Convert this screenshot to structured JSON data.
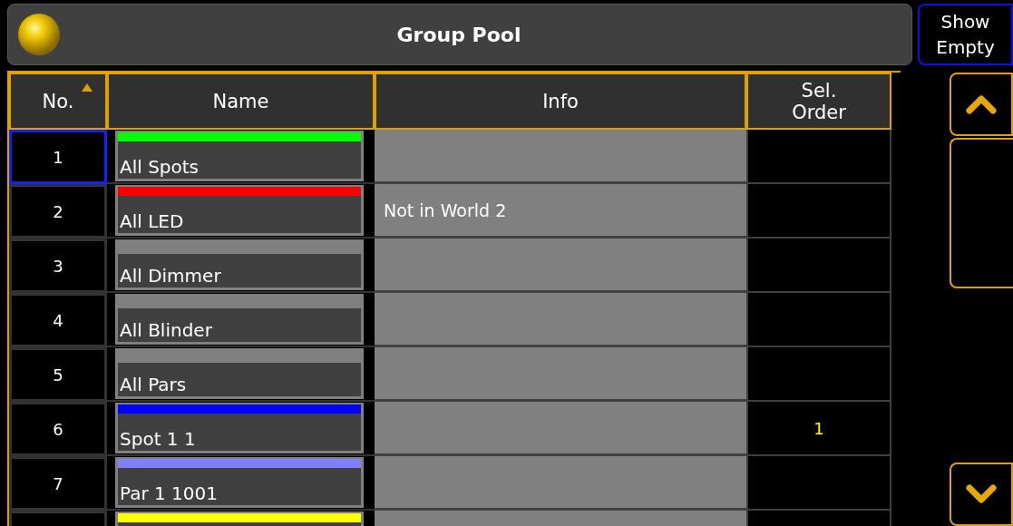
{
  "window": {
    "title": "Group Pool"
  },
  "show_empty_button": {
    "label": "Show\nEmpty"
  },
  "table": {
    "columns": [
      {
        "label": "No.",
        "sorted": true
      },
      {
        "label": "Name"
      },
      {
        "label": "Info"
      },
      {
        "label": "Sel.\nOrder"
      }
    ],
    "rows": [
      {
        "number": "1",
        "name": "All Spots",
        "color": "#00ff00",
        "selected": true
      },
      {
        "number": "2",
        "name": "All LED",
        "color": "#ff0000",
        "info": "Not in World 2",
        "selected": false
      },
      {
        "number": "3",
        "name": "All Dimmer",
        "selected": false
      },
      {
        "number": "4",
        "name": "All Blinder",
        "selected": false
      },
      {
        "number": "5",
        "name": "All Pars",
        "selected": false
      },
      {
        "number": "6",
        "name": "Spot 1 1",
        "color": "#0000ff",
        "sel_order": "1",
        "selected": false
      },
      {
        "number": "7",
        "name": "Par 1 1001",
        "color": "#8080ff",
        "selected": false
      },
      {
        "color": "#ffff00",
        "selected": false
      }
    ]
  }
}
